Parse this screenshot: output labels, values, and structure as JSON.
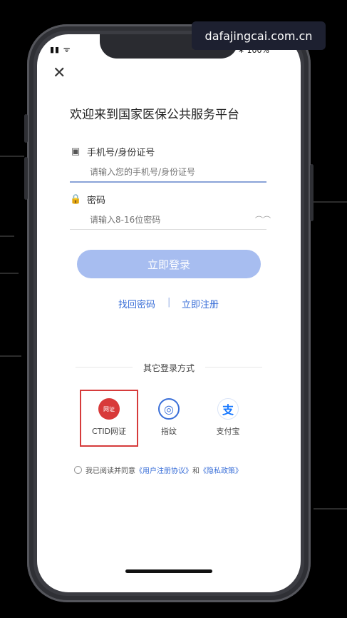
{
  "watermark": "dafajingcai.com.cn",
  "status": {
    "signal": "▮▮ ᯤ",
    "battery": "∗ 100%"
  },
  "icons": {
    "close": "✕",
    "phone": "▣",
    "lock": "🔒",
    "eye": "⌒⌒"
  },
  "title": "欢迎来到国家医保公共服务平台",
  "phone_field": {
    "label": "手机号/身份证号",
    "placeholder": "请输入您的手机号/身份证号"
  },
  "password_field": {
    "label": "密码",
    "placeholder": "请输入8-16位密码"
  },
  "login_button": "立即登录",
  "links": {
    "forgot": "找回密码",
    "separator": "|",
    "register": "立即注册"
  },
  "other_methods": {
    "title": "其它登录方式",
    "items": [
      {
        "label": "CTID网证",
        "icon": "网证"
      },
      {
        "label": "指纹",
        "icon": "◎"
      },
      {
        "label": "支付宝",
        "icon": "支"
      }
    ]
  },
  "agreement": {
    "prefix": "我已阅读并同意",
    "user_agreement": "《用户注册协议》",
    "and": "和",
    "privacy": "《隐私政策》"
  },
  "colors": {
    "accent": "#3a6fd8",
    "button": "#a7bdf0",
    "highlight": "#d63b3b"
  }
}
